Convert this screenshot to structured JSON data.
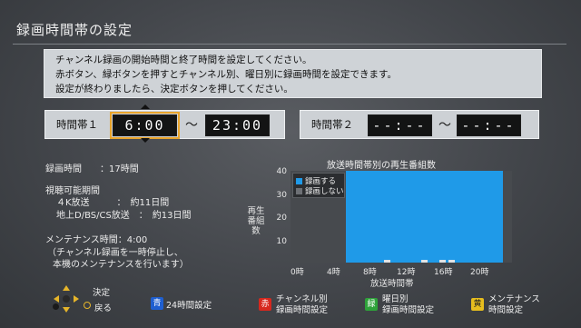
{
  "screen_title": "録画時間帯の設定",
  "instructions": [
    "チャンネル録画の開始時間と終了時間を設定してください。",
    "赤ボタン、緑ボタンを押すとチャンネル別、曜日別に録画時間を設定できます。",
    "設定が終わりましたら、決定ボタンを押してください。"
  ],
  "slots": [
    {
      "label": "時間帯１",
      "start": "6:00",
      "end": "23:00",
      "sep": "〜"
    },
    {
      "label": "時間帯２",
      "start": "--:--",
      "end": "--:--",
      "sep": "〜"
    }
  ],
  "info": {
    "rec_time": "録画時間　　：17時間",
    "viewable_heading": "視聴可能期間",
    "viewable_4k": "４K放送　　　：　約11日間",
    "viewable_terrestrial": "地上D/BS/CS放送　：　約13日間",
    "maintenance": "メンテナンス時間：4:00",
    "maint_note1": "（チャンネル録画を一時停止し、",
    "maint_note2": "本機のメンテナンスを行います）"
  },
  "chart_data": {
    "type": "bar",
    "title": "放送時間帯別の再生番組数",
    "ylabel": "再生番組数",
    "xlabel": "放送時間帯",
    "ylim": [
      0,
      40
    ],
    "yticks": [
      "40",
      "30",
      "20",
      "10"
    ],
    "xticks": [
      "0時",
      "4時",
      "8時",
      "12時",
      "16時",
      "20時"
    ],
    "legend": [
      "録画する",
      "録画しない"
    ],
    "record_hours": [
      6,
      23
    ],
    "hourly_counts": [
      0,
      0,
      0,
      0,
      0,
      0,
      0,
      0,
      0,
      0,
      1,
      0,
      0,
      0,
      1,
      0,
      1,
      1,
      0,
      0,
      0,
      0,
      0,
      0
    ],
    "colors": {
      "record": "#1f9ae8",
      "norecord": "#474a4e",
      "counts": "#dfe3e6"
    }
  },
  "footer": {
    "decide": "決定",
    "back": "戻る",
    "blue_key": "青",
    "blue_label": "24時間設定",
    "red_key": "赤",
    "red_label1": "チャンネル別",
    "red_label2": "録画時間設定",
    "green_key": "緑",
    "green_label1": "曜日別",
    "green_label2": "録画時間設定",
    "yellow_key": "黄",
    "yellow_label1": "メンテナンス",
    "yellow_label2": "時間設定"
  }
}
